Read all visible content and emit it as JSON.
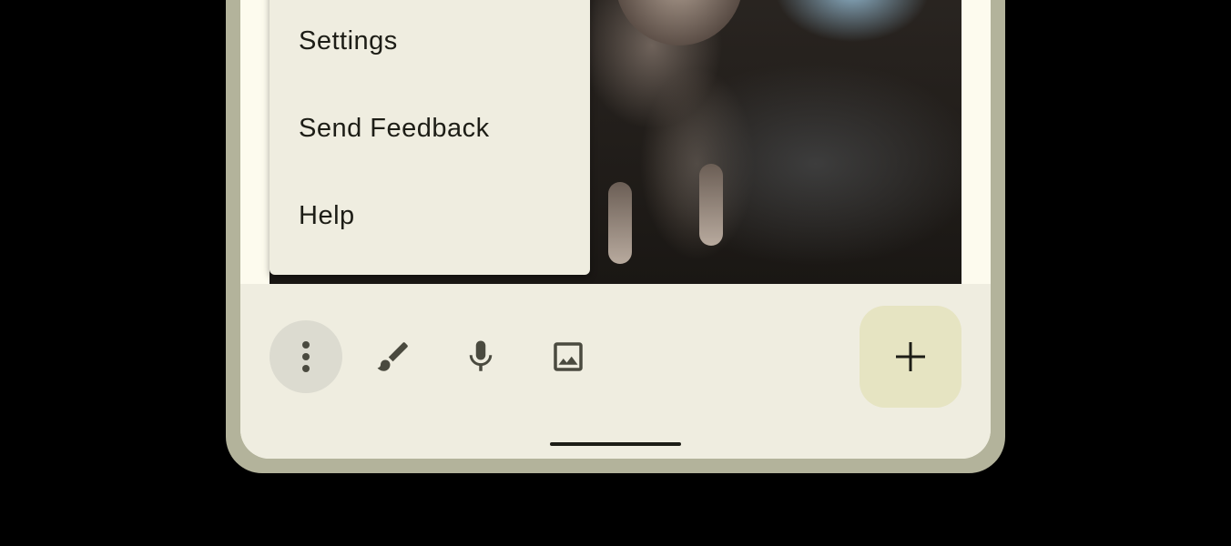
{
  "overflow_menu": {
    "items": [
      {
        "label": "Settings"
      },
      {
        "label": "Send Feedback"
      },
      {
        "label": "Help"
      }
    ]
  },
  "toolbar": {
    "icons": [
      "more-vert-icon",
      "brush-icon",
      "mic-icon",
      "image-icon"
    ],
    "fab_icon": "add-icon"
  },
  "colors": {
    "background": "#000000",
    "device_frame": "#b3b39b",
    "surface": "#efede0",
    "fab": "#e6e4c2",
    "on_surface": "#1d1d16",
    "icon": "#4a4a3f"
  }
}
